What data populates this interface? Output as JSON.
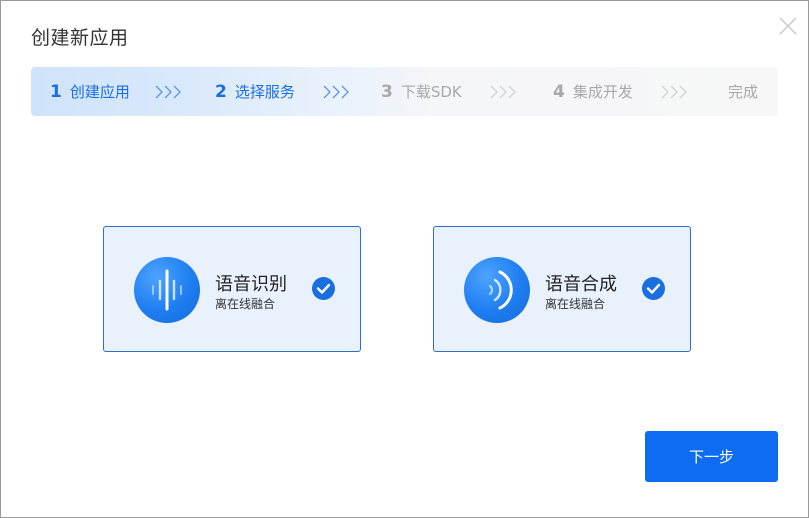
{
  "dialog": {
    "title": "创建新应用",
    "close_icon": "close-icon"
  },
  "steps": [
    {
      "num": "1",
      "label": "创建应用",
      "state": "active"
    },
    {
      "num": "2",
      "label": "选择服务",
      "state": "active"
    },
    {
      "num": "3",
      "label": "下载SDK",
      "state": "inactive"
    },
    {
      "num": "4",
      "label": "集成开发",
      "state": "inactive"
    },
    {
      "num": "",
      "label": "完成",
      "state": "inactive"
    }
  ],
  "services": [
    {
      "name": "语音识别",
      "sub": "离在线融合",
      "icon": "sound-wave-icon",
      "checked": true
    },
    {
      "name": "语音合成",
      "sub": "离在线融合",
      "icon": "speaker-wave-icon",
      "checked": true
    }
  ],
  "actions": {
    "next_label": "下一步"
  },
  "colors": {
    "accent": "#1a6fe0",
    "button": "#0d6cf2",
    "card_bg": "#e8f1fc",
    "card_border": "#2e6fc9",
    "inactive": "#a8a8a8"
  }
}
